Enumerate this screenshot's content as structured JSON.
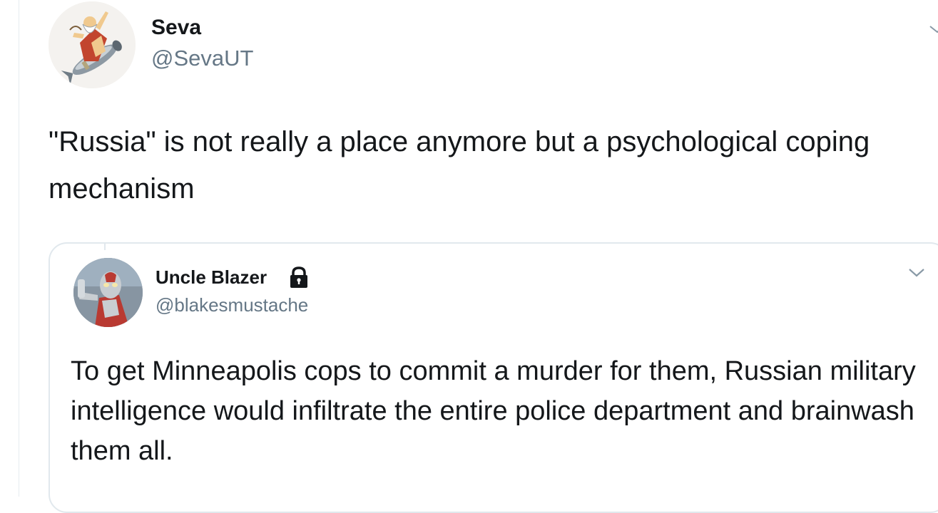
{
  "tweet": {
    "author": {
      "display_name": "Seva",
      "handle": "@SevaUT",
      "avatar_icon": "cartoon-rider-on-missile-avatar"
    },
    "text": "\"Russia\" is not really a place anymore but a psychological coping mechanism",
    "menu_icon": "chevron-down-icon"
  },
  "quoted_tweet": {
    "author": {
      "display_name": "Uncle Blazer",
      "handle": "@blakesmustache",
      "avatar_icon": "red-silver-superhero-avatar",
      "protected_icon": "lock-icon"
    },
    "text": "To get Minneapolis cops to commit a murder for them, Russian military intelligence would infiltrate the entire police department and brainwash them all.",
    "menu_icon": "chevron-down-icon"
  },
  "colors": {
    "text_primary": "#14171a",
    "text_secondary": "#657786",
    "border": "#e1e8ed"
  }
}
